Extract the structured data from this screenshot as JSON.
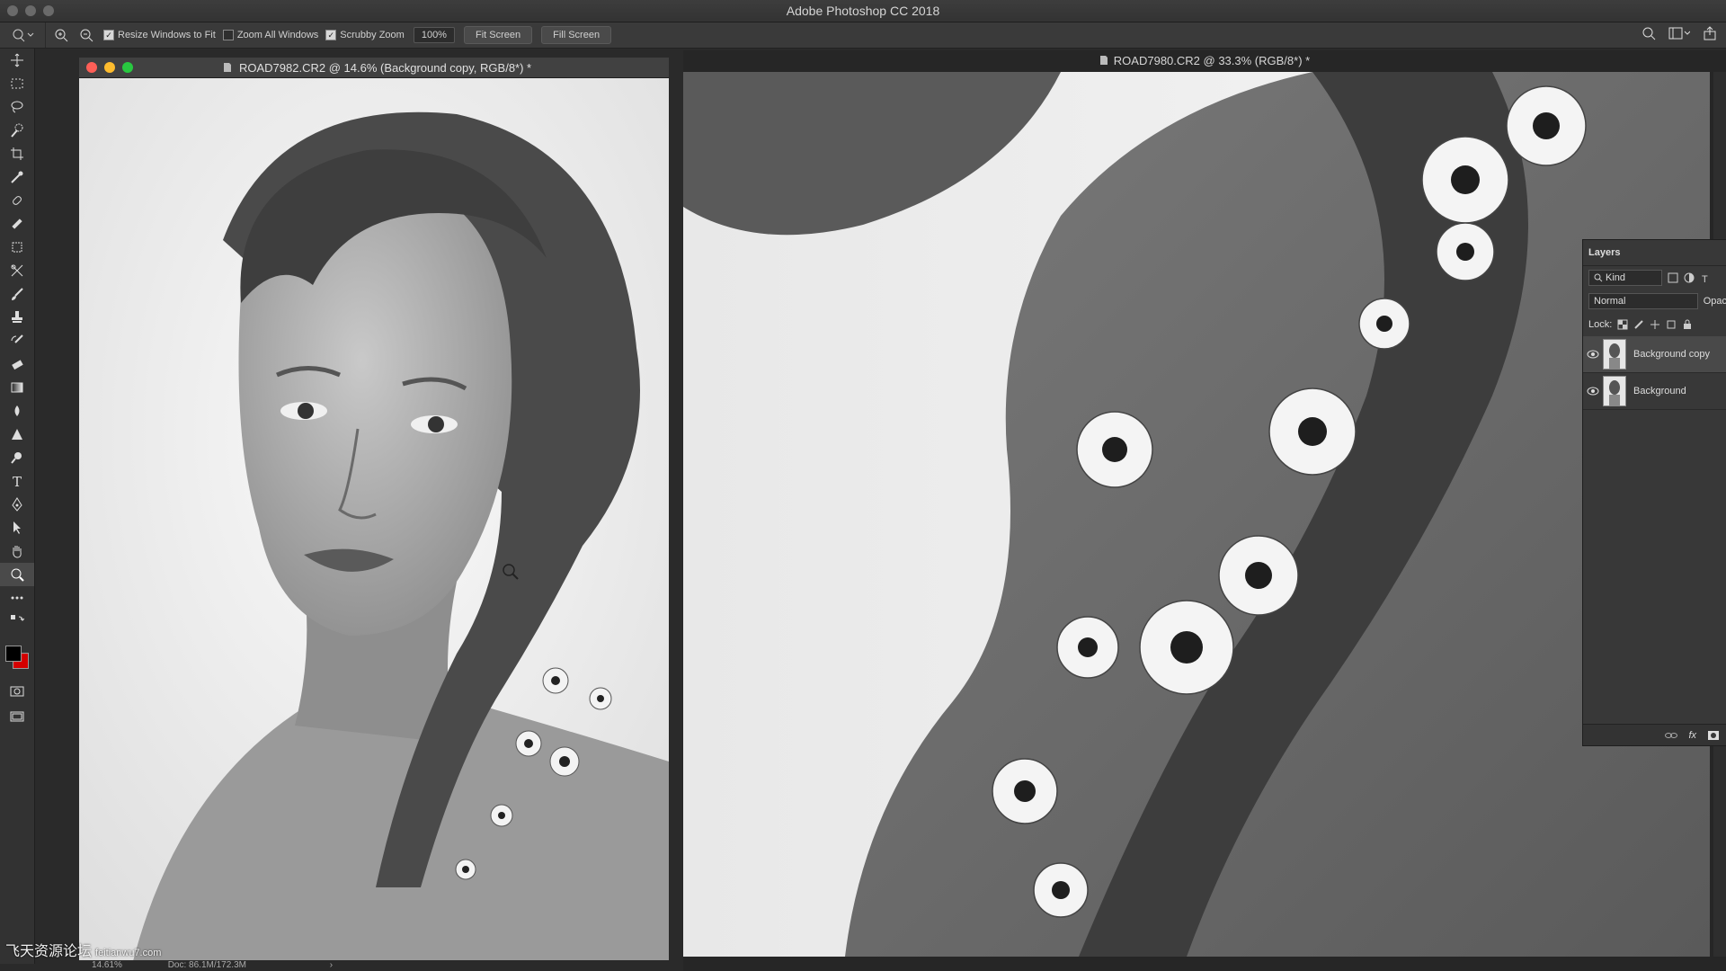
{
  "app": {
    "title": "Adobe Photoshop CC 2018"
  },
  "options_bar": {
    "resize_windows": "Resize Windows to Fit",
    "zoom_all_windows": "Zoom All Windows",
    "scrubby_zoom": "Scrubby Zoom",
    "zoom_value": "100%",
    "fit_screen": "Fit Screen",
    "fill_screen": "Fill Screen"
  },
  "doc_left": {
    "tab_title": "ROAD7982.CR2 @ 14.6% (Background copy, RGB/8*) *",
    "status_zoom": "14.61%",
    "status_doc": "Doc: 86.1M/172.3M"
  },
  "doc_right": {
    "tab_title": "ROAD7980.CR2 @ 33.3% (RGB/8*) *"
  },
  "layers_panel": {
    "title": "Layers",
    "kind_filter": "Kind",
    "blend_mode": "Normal",
    "opacity_label": "Opac",
    "lock_label": "Lock:",
    "layers": [
      {
        "name": "Background copy",
        "visible": true,
        "selected": true
      },
      {
        "name": "Background",
        "visible": true,
        "selected": false
      }
    ]
  },
  "watermark": {
    "text": "飞天资源论坛",
    "url": "feitianwu7.com"
  },
  "colors": {
    "foreground": "#000000",
    "background": "#d40000"
  }
}
